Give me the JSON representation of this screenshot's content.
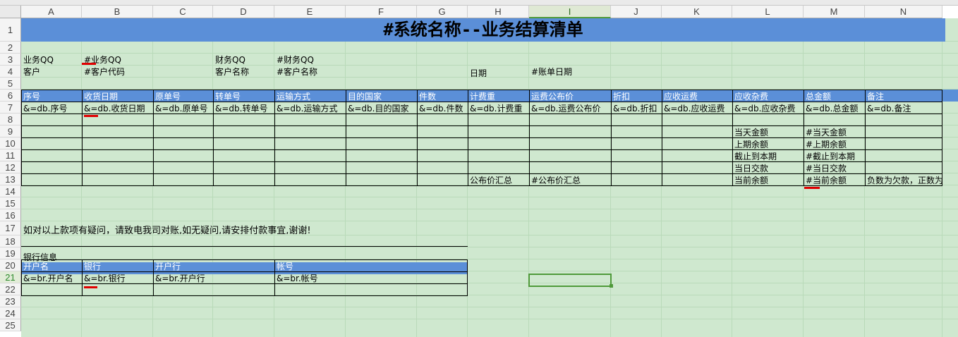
{
  "columns": [
    "A",
    "B",
    "C",
    "D",
    "E",
    "F",
    "G",
    "H",
    "I",
    "J",
    "K",
    "L",
    "M",
    "N"
  ],
  "active_column": "I",
  "rows": [
    "1",
    "2",
    "3",
    "4",
    "5",
    "6",
    "7",
    "8",
    "9",
    "10",
    "11",
    "12",
    "13",
    "14",
    "15",
    "16",
    "17",
    "18",
    "19",
    "20",
    "21",
    "22",
    "23",
    "24",
    "25"
  ],
  "active_row": "21",
  "title": "#系统名称--业务结算清单",
  "info": {
    "biz_qq_label": "业务QQ",
    "biz_qq_value": "#业务QQ",
    "fin_qq_label": "财务QQ",
    "fin_qq_value": "#财务QQ",
    "customer_label": "客户",
    "customer_code": "#客户代码",
    "customer_name_label": "客户名称",
    "customer_name_value": "#客户名称",
    "date_label": "日期",
    "date_value": "#账单日期"
  },
  "main_table": {
    "headers": [
      "序号",
      "收货日期",
      "原单号",
      "转单号",
      "运输方式",
      "目的国家",
      "件数",
      "计费重",
      "运费公布价",
      "折扣",
      "应收运费",
      "应收杂费",
      "总金额",
      "备注"
    ],
    "fields": [
      "&=db.序号",
      "&=db.收货日期",
      "&=db.原单号",
      "&=db.转单号",
      "&=db.运输方式",
      "&=db.目的国家",
      "&=db.件数",
      "&=db.计费重",
      "&=db.运费公布价",
      "&=db.折扣",
      "&=db.应收运费",
      "&=db.应收杂费",
      "&=db.总金额",
      "&=db.备注"
    ]
  },
  "summary": {
    "labels": [
      "当天金额",
      "上期余额",
      "截止到本期",
      "当日交款",
      "当前余额"
    ],
    "values": [
      "#当天金额",
      "#上期余额",
      "#截止到本期",
      "#当日交款",
      "#当前余额"
    ],
    "price_total_label": "公布价汇总",
    "price_total_value": "#公布价汇总",
    "note": "负数为欠款，正数为"
  },
  "message": "如对以上款项有疑问，请致电我司对账,如无疑问,请安排付款事宜,谢谢!",
  "bank": {
    "title": "银行信息",
    "headers": [
      "开户名",
      "银行",
      "开户行",
      "帐号"
    ],
    "fields": [
      "&=br.开户名",
      "&=br.银行",
      "&=br.开户行",
      "&=br.帐号"
    ]
  },
  "colors": {
    "grid_background": "#cfe8cf",
    "header_band": "#5b8fd8",
    "selection": "#4f9a3a",
    "annotation_mark": "#e00000"
  }
}
